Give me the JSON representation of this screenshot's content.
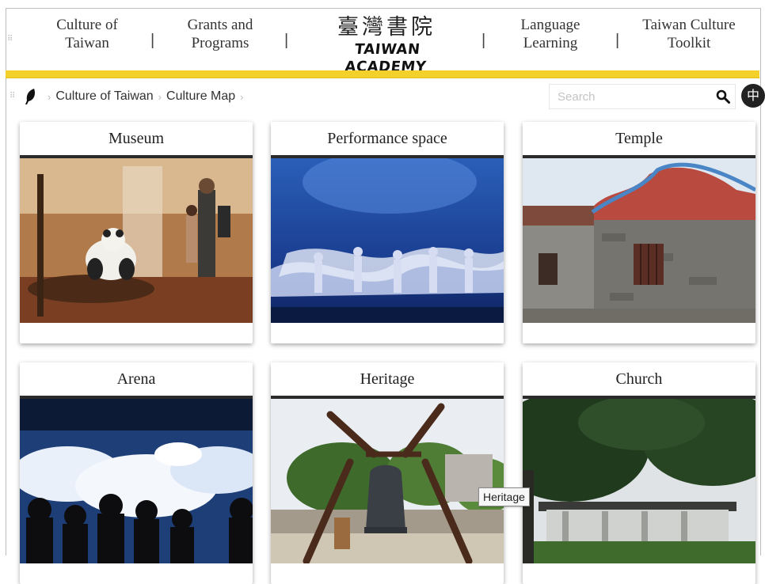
{
  "nav": {
    "left": [
      {
        "line1": "Culture of",
        "line2": "Taiwan"
      },
      {
        "line1": "Grants and",
        "line2": "Programs"
      }
    ],
    "logo": {
      "cn": "臺灣書院",
      "en": "TAIWAN ACADEMY"
    },
    "right": [
      {
        "line1": "Language",
        "line2": "Learning"
      },
      {
        "line1": "Taiwan Culture",
        "line2": "Toolkit"
      }
    ],
    "separator": "|"
  },
  "breadcrumb": {
    "items": [
      "Culture of Taiwan",
      "Culture Map"
    ],
    "separator": "›"
  },
  "search": {
    "placeholder": "Search"
  },
  "language_toggle": {
    "label": "中"
  },
  "cards": [
    {
      "title": "Museum"
    },
    {
      "title": "Performance space"
    },
    {
      "title": "Temple"
    },
    {
      "title": "Arena"
    },
    {
      "title": "Heritage"
    },
    {
      "title": "Church"
    }
  ],
  "tooltip": {
    "text": "Heritage"
  },
  "colors": {
    "accent_bar": "#f4d12a",
    "title_rule": "#2b2b2b"
  }
}
